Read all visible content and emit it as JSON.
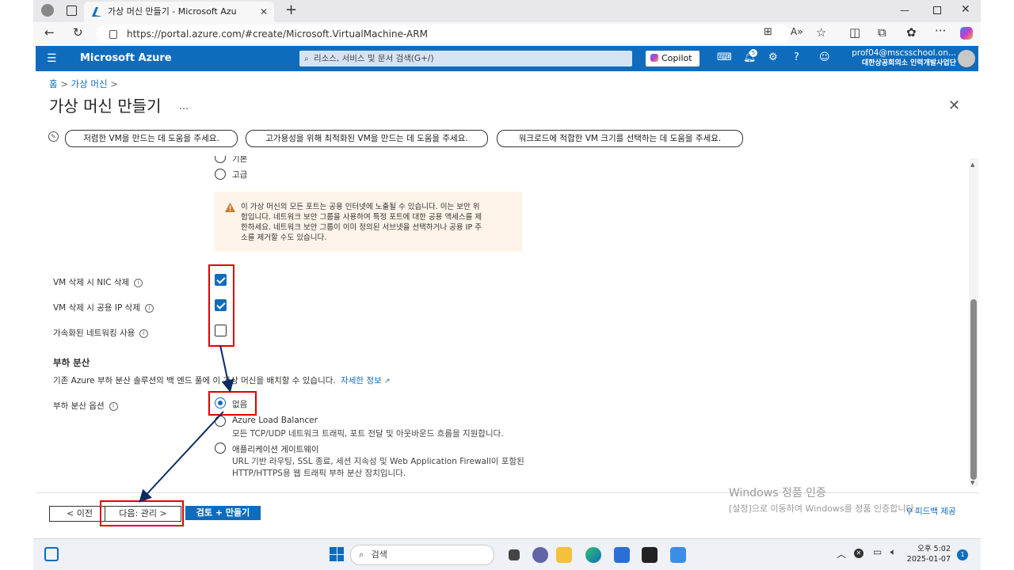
{
  "browser": {
    "tab_title": "가상 머신 만들기 - Microsoft Azu",
    "new_tab": "+",
    "url": "https://portal.azure.com/#create/Microsoft.VirtualMachine-ARM"
  },
  "azure_header": {
    "brand": "Microsoft Azure",
    "search_placeholder": "리소스, 서비스 및 문서 검색(G+/)",
    "copilot": "Copilot",
    "notification_count": "5",
    "account_email": "prof04@mscsschool.on...",
    "account_org": "대한상공회의소 인력개발사업단"
  },
  "breadcrumb": {
    "home": "홈",
    "vm": "가상 머신"
  },
  "page": {
    "title": "가상 머신 만들기",
    "more": "..."
  },
  "copilot_prompts": [
    "저렴한 VM을 만드는 데 도움을 주세요.",
    "고가용성을 위해 최적화된 VM을 만드는 데 도움을 주세요.",
    "워크로드에 적합한 VM 크기를 선택하는 데 도움을 주세요."
  ],
  "nsg": {
    "partial_option": "기본",
    "advanced_option": "고급",
    "warning_lines": [
      "이 가상 머신의 모든 포트는 공용 인터넷에 노출될 수 있습니다. 이는 보안 위",
      "험입니다. 네트워크 보안 그룹을 사용하여 특정 포트에 대한 공용 액세스를 제",
      "한하세요. 네트워크 보안 그룹이 이미 정의된 서브넷을 선택하거나 공용 IP 주",
      "소를 제거할 수도 있습니다."
    ]
  },
  "checkboxes": [
    {
      "label": "VM 삭제 시 NIC 삭제",
      "checked": true
    },
    {
      "label": "VM 삭제 시 공용 IP 삭제",
      "checked": true
    },
    {
      "label": "가속화된 네트워킹 사용",
      "checked": false
    }
  ],
  "load_balancing": {
    "heading": "부하 분산",
    "description": "기존 Azure 부하 분산 솔루션의 백 엔드 풀에 이 가상 머신을 배치할 수 있습니다.",
    "learn_more": "자세한 정보",
    "option_label": "부하 분산 옵션",
    "options": [
      {
        "label": "없음",
        "desc": "",
        "selected": true
      },
      {
        "label": "Azure Load Balancer",
        "desc": "모든 TCP/UDP 네트워크 트래픽, 포트 전달 및 아웃바운드 흐름을 지원합니다.",
        "selected": false
      },
      {
        "label": "애플리케이션 게이트웨이",
        "desc": "URL 기반 라우팅, SSL 종료, 세션 지속성 및 Web Application Firewall이 포함된",
        "desc2": "HTTP/HTTPS용 웹 트래픽 부하 분산 장치입니다.",
        "selected": false
      }
    ]
  },
  "footer": {
    "prev": "< 이전",
    "next": "다음: 관리 >",
    "review": "검토 + 만들기",
    "feedback": "피드백 제공"
  },
  "watermark": {
    "line1": "Windows 정품 인증",
    "line2": "[설정]으로 이동하여 Windows를 정품 인증합니다."
  },
  "taskbar": {
    "search": "검색",
    "time": "오후 5:02",
    "date": "2025-01-07",
    "badge": "1"
  },
  "colors": {
    "azure_blue": "#0f6cbd",
    "annotation_red": "#e00000",
    "annotation_arrow": "#0a2a66"
  }
}
